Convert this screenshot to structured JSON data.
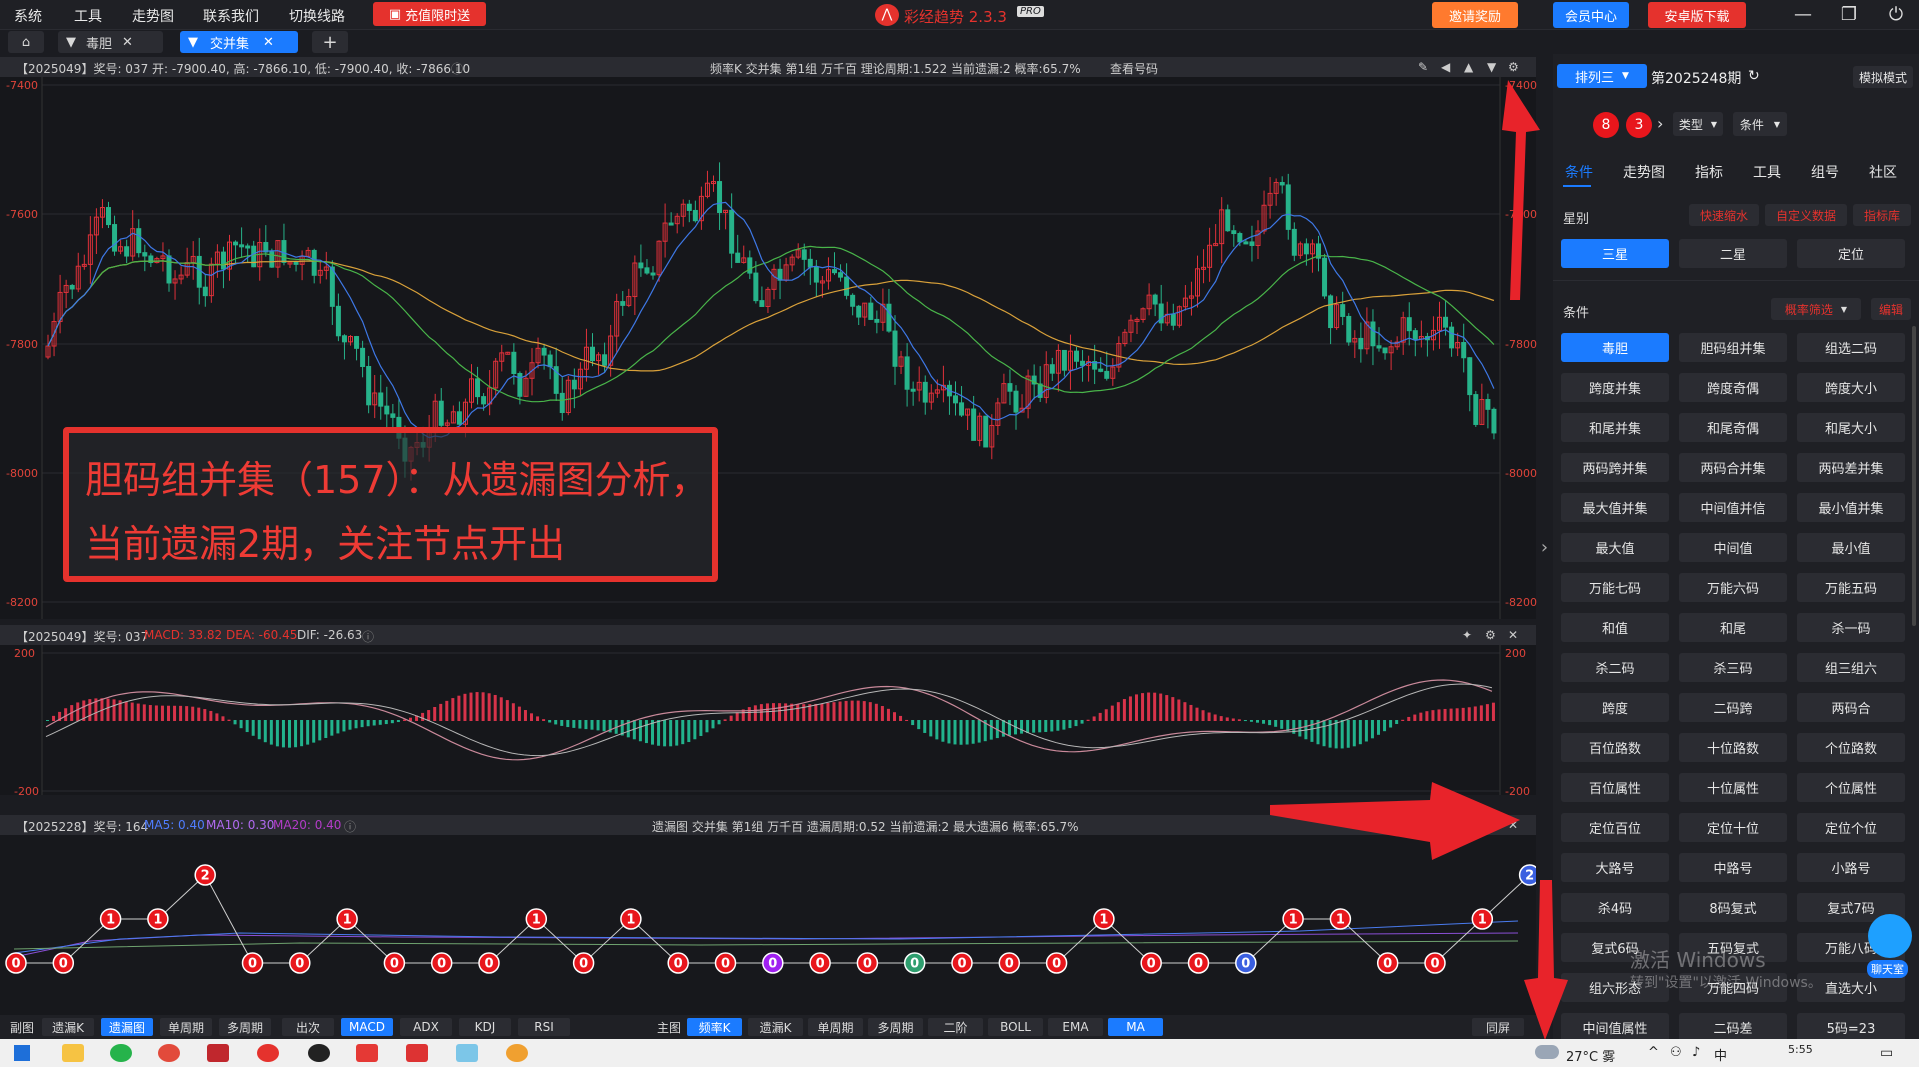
{
  "menu": [
    "系统",
    "工具",
    "走势图",
    "联系我们",
    "切换线路"
  ],
  "promo_label": "充值限时送",
  "app_title": "彩经趋势 2.3.3",
  "app_badge": "PRO",
  "invite_label": "邀请奖励",
  "member_label": "会员中心",
  "android_label": "安卓版下载",
  "tabs": [
    {
      "label": "毒胆"
    },
    {
      "label": "交并集"
    }
  ],
  "main_header": {
    "info": "【2025049】奖号: 037  开: -7900.40, 高: -7866.10, 低: -7900.40, 收: -7866.10",
    "right": "频率K  交并集  第1组  万千百  理论周期:1.522  当前遗漏:2  概率:65.7%",
    "check": "查看号码"
  },
  "main_axis": [
    "-7400",
    "-7600",
    "-7800",
    "-8000",
    "-8200"
  ],
  "macd_header": {
    "info": "【2025049】奖号: 037",
    "macd": "MACD: 33.82",
    "dea": "DEA: -60.45",
    "dif": "DIF: -26.63"
  },
  "macd_axis": [
    "200",
    "-200"
  ],
  "omit_header": {
    "info": "【2025228】奖号: 164",
    "ma5": "MA5: 0.40",
    "ma10": "MA10: 0.30",
    "ma20": "MA20: 0.40",
    "right": "遗漏图  交并集  第1组  万千百  遗漏周期:0.52  当前遗漏:2  最大遗漏6  概率:65.7%"
  },
  "overlay": {
    "line1": "胆码组并集（157）：从遗漏图分析，",
    "line2": "当前遗漏2期，关注节点开出"
  },
  "omission_nodes": [
    0,
    0,
    1,
    1,
    2,
    0,
    0,
    1,
    0,
    0,
    0,
    1,
    0,
    1,
    0,
    0,
    0,
    0,
    0,
    0,
    0,
    0,
    0,
    1,
    0,
    0,
    0,
    1,
    1,
    0,
    0,
    1,
    2
  ],
  "node_colors": {
    "red": "#e8161c",
    "purple": "#a020f0",
    "green": "#2e9e6e",
    "blue": "#3a5fe0"
  },
  "bottom_left": {
    "label": "副图",
    "items": [
      "遗漏K",
      "遗漏图",
      "单周期",
      "多周期",
      "出次",
      "MACD",
      "ADX",
      "KDJ",
      "RSI"
    ]
  },
  "bottom_mid": {
    "label": "主图",
    "items": [
      "频率K",
      "遗漏K",
      "单周期",
      "多周期",
      "二阶",
      "BOLL",
      "EMA",
      "MA"
    ]
  },
  "bottom_right": "同屏",
  "right_panel": {
    "lottery": "排列三",
    "period": "第2025248期",
    "mode": "模拟模式",
    "balls": [
      "8",
      "3"
    ],
    "type": "类型",
    "cond": "条件",
    "tabs": [
      "条件",
      "走势图",
      "指标",
      "工具",
      "组号",
      "社区"
    ],
    "star_title": "星别",
    "star_links": [
      "快速缩水",
      "自定义数据",
      "指标库"
    ],
    "stars": [
      "三星",
      "二星",
      "定位"
    ],
    "cond_title": "条件",
    "filter": "概率筛选",
    "edit": "编辑",
    "buttons": [
      "毒胆",
      "胆码组并集",
      "组选二码",
      "跨度并集",
      "跨度奇偶",
      "跨度大小",
      "和尾并集",
      "和尾奇偶",
      "和尾大小",
      "两码跨并集",
      "两码合并集",
      "两码差并集",
      "最大值并集",
      "中间值并信",
      "最小值并集",
      "最大值",
      "中间值",
      "最小值",
      "万能七码",
      "万能六码",
      "万能五码",
      "和值",
      "和尾",
      "杀一码",
      "杀二码",
      "杀三码",
      "组三组六",
      "跨度",
      "二码跨",
      "两码合",
      "百位路数",
      "十位路数",
      "个位路数",
      "百位属性",
      "十位属性",
      "个位属性",
      "定位百位",
      "定位十位",
      "定位个位",
      "大路号",
      "中路号",
      "小路号",
      "杀4码",
      "8码复式",
      "复式7码",
      "复式6码",
      "五码复式",
      "万能八码",
      "组六形态",
      "万能四码",
      "直选大小",
      "中间值属性",
      "二码差",
      "5码=23"
    ],
    "chat": "聊天室"
  },
  "watermark": {
    "line1": "激活 Windows",
    "line2": "转到\"设置\"以激活 Windows。"
  },
  "taskbar": {
    "weather": "27°C 雾",
    "time": "5:55",
    "ime": "中"
  }
}
